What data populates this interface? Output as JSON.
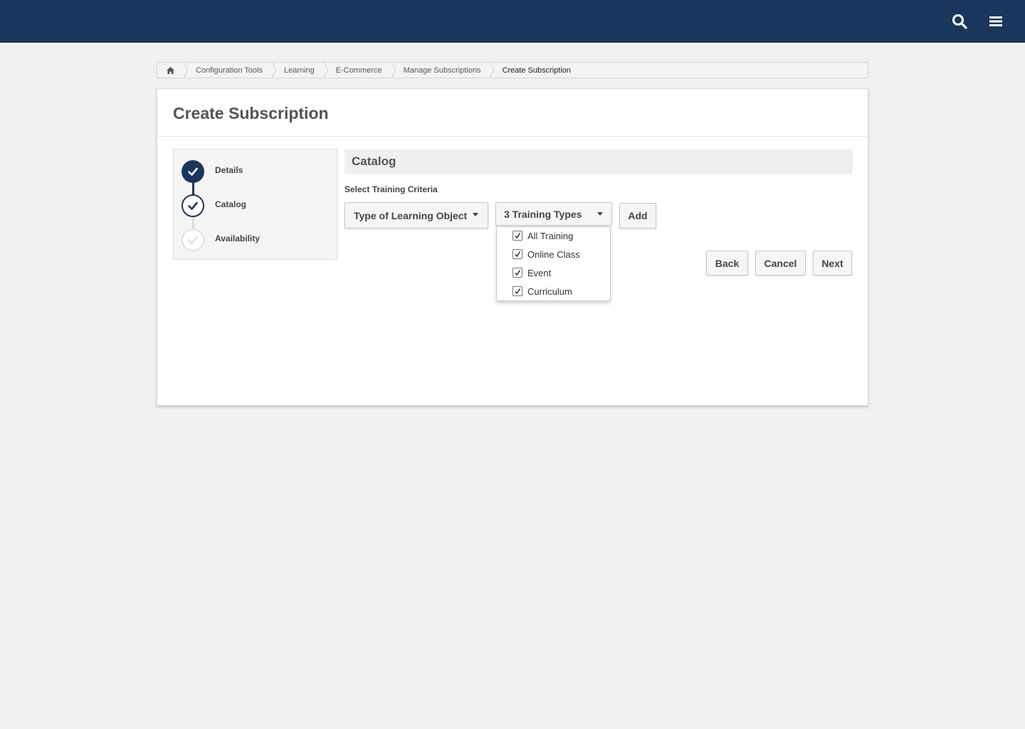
{
  "header": {
    "icons": [
      "search-icon",
      "menu-icon"
    ],
    "bg_color": "#1b365d"
  },
  "breadcrumb": {
    "home_icon": "home-icon",
    "items": [
      "Configuration Tools",
      "Learning",
      "E-Commerce",
      "Manage Subscriptions",
      "Create Subscription"
    ]
  },
  "page": {
    "title": "Create Subscription"
  },
  "steps": [
    {
      "label": "Details",
      "state": "completed"
    },
    {
      "label": "Catalog",
      "state": "current"
    },
    {
      "label": "Availability",
      "state": "pending"
    }
  ],
  "catalog": {
    "section_title": "Catalog",
    "criteria_label": "Select Training Criteria",
    "criteria_dropdown": "Type of Learning Object",
    "types_dropdown": "3 Training Types",
    "add_label": "Add",
    "options": [
      {
        "label": "All Training",
        "checked": true
      },
      {
        "label": "Online Class",
        "checked": true
      },
      {
        "label": "Event",
        "checked": true
      },
      {
        "label": "Curriculum",
        "checked": true
      }
    ]
  },
  "actions": {
    "back": "Back",
    "cancel": "Cancel",
    "next": "Next"
  }
}
